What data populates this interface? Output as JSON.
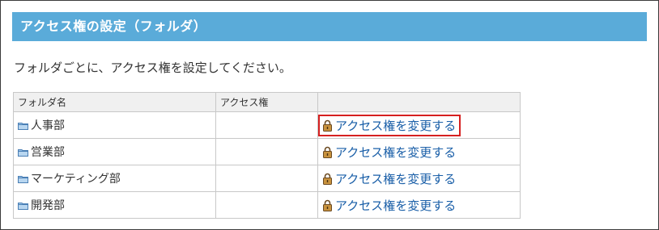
{
  "header": {
    "title": "アクセス権の設定（フォルダ）"
  },
  "description": "フォルダごとに、アクセス権を設定してください。",
  "table": {
    "columns": [
      "フォルダ名",
      "アクセス権",
      ""
    ],
    "rows": [
      {
        "folder": "人事部",
        "access": "",
        "action": "アクセス権を変更する",
        "highlighted": true
      },
      {
        "folder": "営業部",
        "access": "",
        "action": "アクセス権を変更する",
        "highlighted": false
      },
      {
        "folder": "マーケティング部",
        "access": "",
        "action": "アクセス権を変更する",
        "highlighted": false
      },
      {
        "folder": "開発部",
        "access": "",
        "action": "アクセス権を変更する",
        "highlighted": false
      }
    ]
  },
  "icons": {
    "folder": "folder-icon",
    "lock": "lock-icon"
  },
  "colors": {
    "header_bg": "#5aabd9",
    "link": "#1a5fa8",
    "highlight_border": "#d62020"
  }
}
